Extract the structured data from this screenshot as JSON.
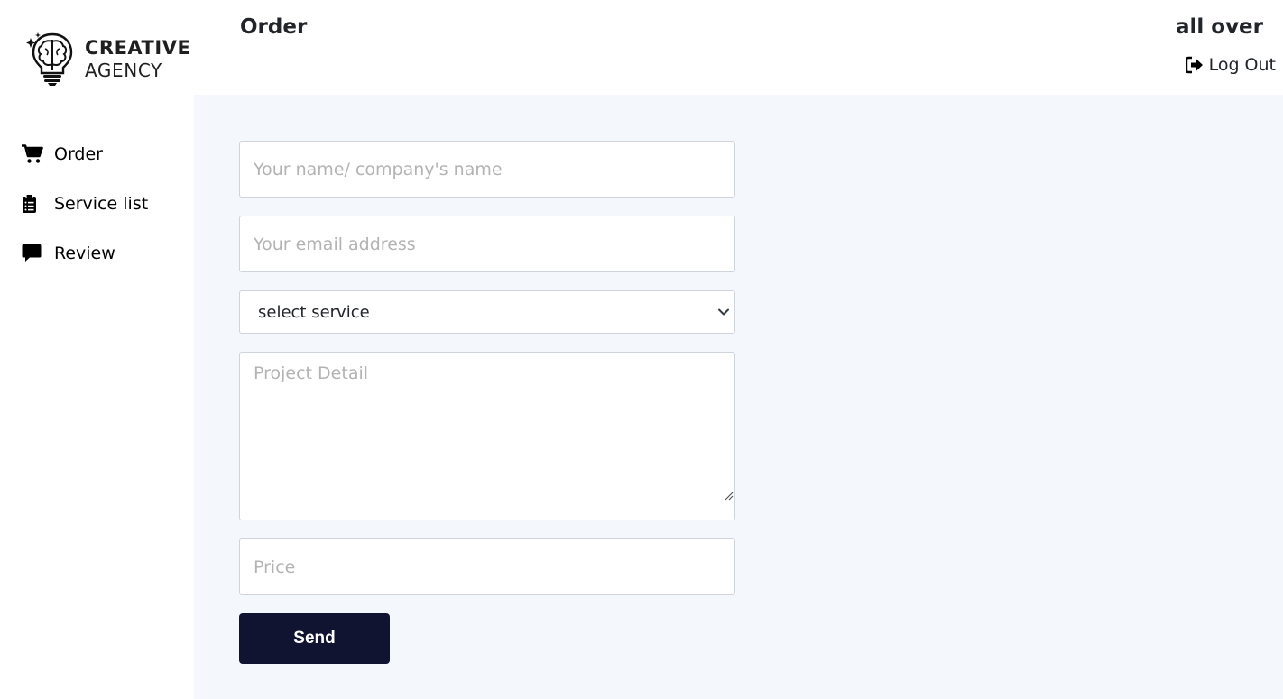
{
  "brand": {
    "line1": "CREATIVE",
    "line2": "AGENCY",
    "icon": "brain-lightbulb-icon"
  },
  "sidebar": {
    "items": [
      {
        "label": "Order",
        "icon": "cart-icon"
      },
      {
        "label": "Service list",
        "icon": "clipboard-list-icon"
      },
      {
        "label": "Review",
        "icon": "comment-icon"
      }
    ]
  },
  "header": {
    "title": "Order",
    "user_name": "all over",
    "logout_label": "Log Out",
    "logout_icon": "sign-out-icon"
  },
  "form": {
    "name_placeholder": "Your name/ company's name",
    "email_placeholder": "Your email address",
    "service_select": {
      "selected": "select service",
      "icon": "chevron-down-icon"
    },
    "detail_placeholder": "Project Detail",
    "price_placeholder": "Price",
    "send_label": "Send"
  },
  "colors": {
    "main_background": "#f4f7fc",
    "button_background": "#111430",
    "button_text": "#ffffff"
  }
}
